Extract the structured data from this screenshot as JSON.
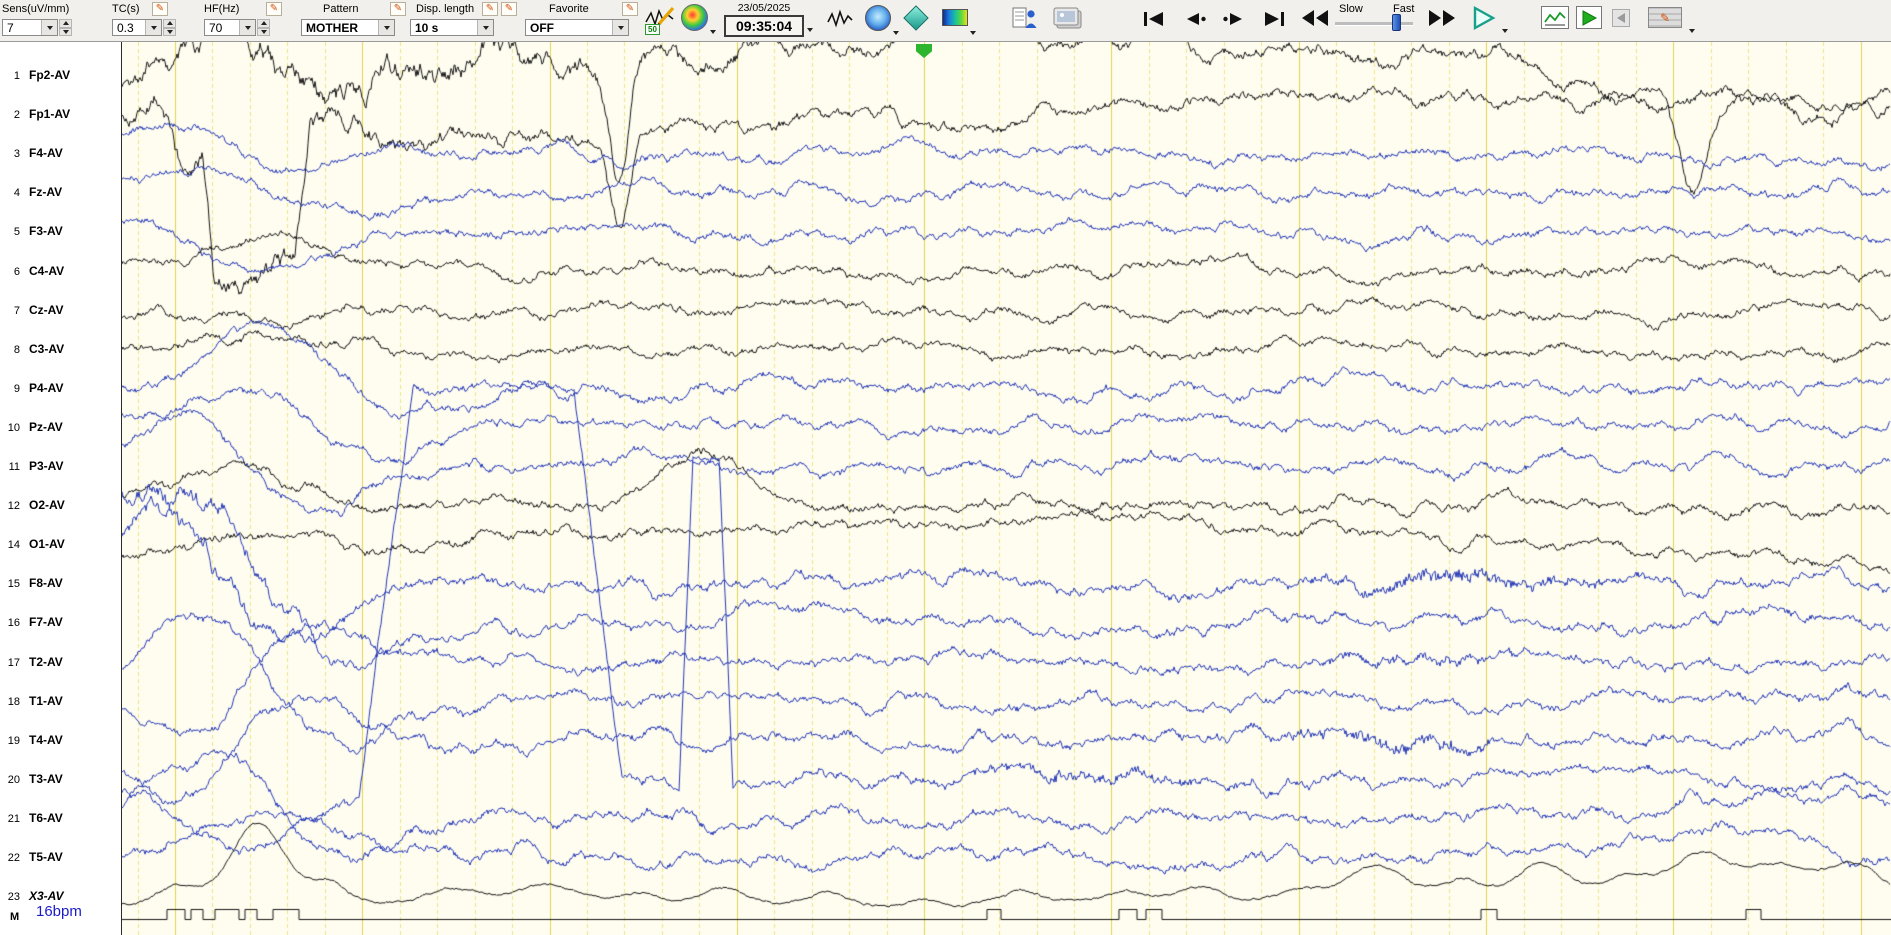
{
  "toolbar": {
    "sens_label": "Sens(uV/mm)",
    "sens_value": "7",
    "tc_label": "TC(s)",
    "tc_value": "0.3",
    "hf_label": "HF(Hz)",
    "hf_value": "70",
    "pattern_label": "Pattern",
    "pattern_value": "MOTHER",
    "disp_label": "Disp. length",
    "disp_value": "10 s",
    "fav_label": "Favorite",
    "fav_value": "OFF",
    "date": "23/05/2025",
    "time": "09:35:04",
    "slow": "Slow",
    "fast": "Fast",
    "tool_badge": "50"
  },
  "icons": {
    "pencil": "✎"
  },
  "channels": [
    {
      "num": "1",
      "label": "Fp2-AV",
      "color": "black"
    },
    {
      "num": "2",
      "label": "Fp1-AV",
      "color": "black"
    },
    {
      "num": "3",
      "label": "F4-AV",
      "color": "blue"
    },
    {
      "num": "4",
      "label": "Fz-AV",
      "color": "blue"
    },
    {
      "num": "5",
      "label": "F3-AV",
      "color": "blue"
    },
    {
      "num": "6",
      "label": "C4-AV",
      "color": "black"
    },
    {
      "num": "7",
      "label": "Cz-AV",
      "color": "black"
    },
    {
      "num": "8",
      "label": "C3-AV",
      "color": "black"
    },
    {
      "num": "9",
      "label": "P4-AV",
      "color": "blue"
    },
    {
      "num": "10",
      "label": "Pz-AV",
      "color": "blue"
    },
    {
      "num": "11",
      "label": "P3-AV",
      "color": "blue"
    },
    {
      "num": "12",
      "label": "O2-AV",
      "color": "black"
    },
    {
      "num": "14",
      "label": "O1-AV",
      "color": "black"
    },
    {
      "num": "15",
      "label": "F8-AV",
      "color": "blue"
    },
    {
      "num": "16",
      "label": "F7-AV",
      "color": "blue"
    },
    {
      "num": "17",
      "label": "T2-AV",
      "color": "blue"
    },
    {
      "num": "18",
      "label": "T1-AV",
      "color": "blue"
    },
    {
      "num": "19",
      "label": "T4-AV",
      "color": "blue"
    },
    {
      "num": "20",
      "label": "T3-AV",
      "color": "blue"
    },
    {
      "num": "21",
      "label": "T6-AV",
      "color": "blue"
    },
    {
      "num": "22",
      "label": "T5-AV",
      "color": "blue",
      "italic": false
    },
    {
      "num": "23",
      "label": "X3-AV",
      "color": "black",
      "italic": true
    }
  ],
  "status": {
    "marker_row_label": "M",
    "bpm": "16bpm"
  },
  "colors": {
    "paper": "#fffdf0",
    "grid_major": "#e0d452",
    "grid_minor": "#ede683",
    "trace_black": "#161616",
    "trace_blue": "#2438b8",
    "bpm_text": "#1a1acc",
    "marker_green": "#2db52d",
    "play_teal": "#17a08c"
  }
}
